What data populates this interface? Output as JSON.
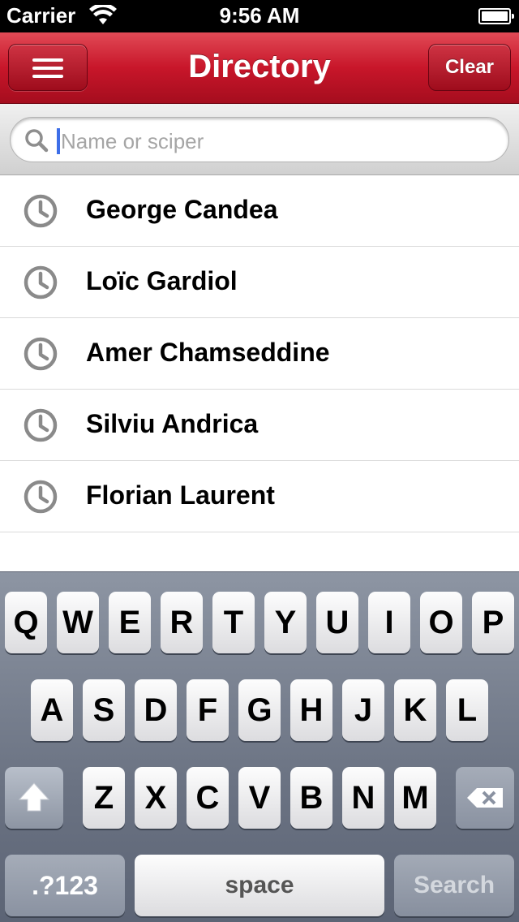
{
  "status_bar": {
    "carrier": "Carrier",
    "time": "9:56 AM",
    "wifi_icon": "wifi-icon",
    "battery_icon": "battery-icon"
  },
  "nav": {
    "title": "Directory",
    "menu_icon": "menu-icon",
    "clear_label": "Clear",
    "color": "#c8162a"
  },
  "search": {
    "placeholder": "Name or sciper",
    "value": "",
    "icon": "search-icon"
  },
  "history": {
    "icon": "clock-icon",
    "items": [
      {
        "name": "George Candea"
      },
      {
        "name": "Loïc Gardiol"
      },
      {
        "name": "Amer Chamseddine"
      },
      {
        "name": "Silviu Andrica"
      },
      {
        "name": "Florian Laurent"
      }
    ]
  },
  "keyboard": {
    "row1": [
      "Q",
      "W",
      "E",
      "R",
      "T",
      "Y",
      "U",
      "I",
      "O",
      "P"
    ],
    "row2": [
      "A",
      "S",
      "D",
      "F",
      "G",
      "H",
      "J",
      "K",
      "L"
    ],
    "row3": [
      "Z",
      "X",
      "C",
      "V",
      "B",
      "N",
      "M"
    ],
    "numbers_label": ".?123",
    "space_label": "space",
    "search_label": "Search",
    "shift_icon": "shift-icon",
    "delete_icon": "backspace-icon"
  }
}
